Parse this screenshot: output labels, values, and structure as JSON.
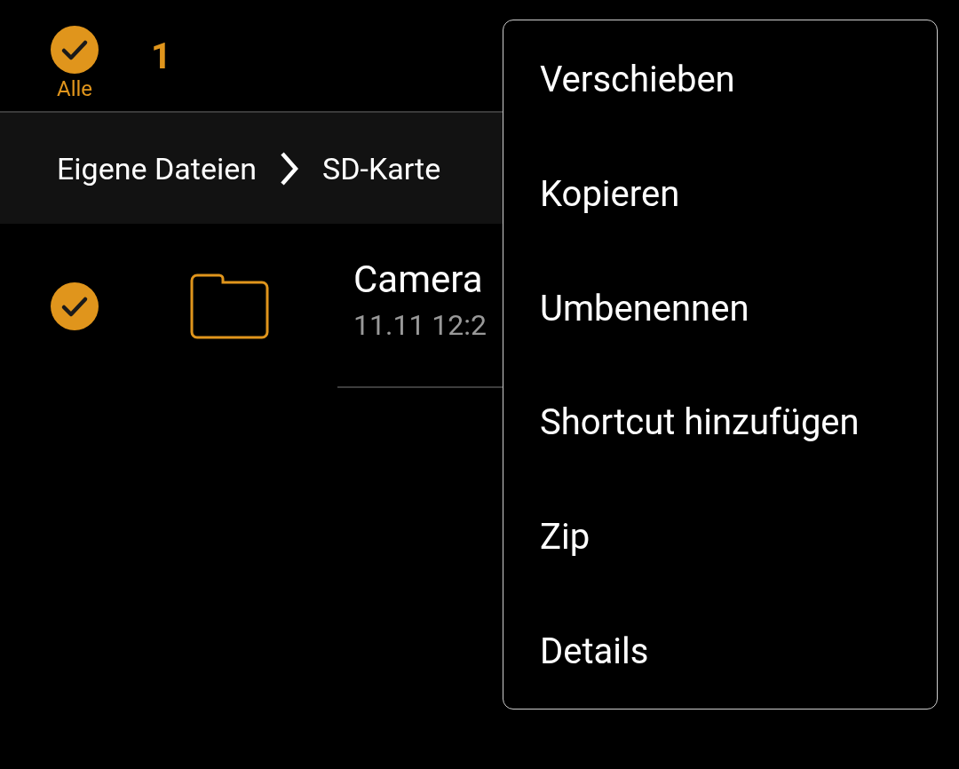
{
  "selection_bar": {
    "select_all_label": "Alle",
    "select_all_checked": true,
    "count": "1"
  },
  "breadcrumb": [
    "Eigene Dateien",
    "SD-Karte"
  ],
  "files": [
    {
      "name": "Camera",
      "date": "11.11 12:2",
      "checked": true
    }
  ],
  "menu": {
    "items": [
      "Verschieben",
      "Kopieren",
      "Umbenennen",
      "Shortcut hinzufügen",
      "Zip",
      "Details"
    ]
  }
}
